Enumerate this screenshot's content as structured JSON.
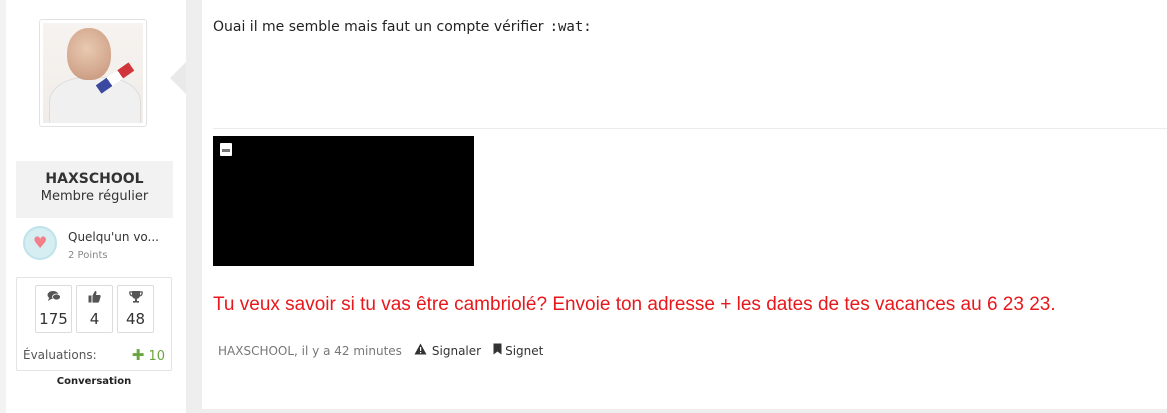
{
  "sidebar": {
    "username": "HAXSCHOOL",
    "user_title": "Membre régulier",
    "rank": {
      "name": "Quelqu'un vo...",
      "points": "2 Points",
      "icon": "heart-icon"
    },
    "stats": [
      {
        "icon": "comments-icon",
        "value": "175"
      },
      {
        "icon": "thumbs-up-icon",
        "value": "4"
      },
      {
        "icon": "trophy-icon",
        "value": "48"
      }
    ],
    "evaluations_label": "Évaluations:",
    "evaluations_value": "10",
    "conversation_label": "Conversation"
  },
  "post": {
    "message": "Ouai il me semble mais faut un compte vérifier",
    "smiley_text": ":wat:",
    "signature": "Tu veux savoir si tu vas être cambriolé? Envoie ton adresse + les dates de tes vacances au 6 23 23.",
    "meta": {
      "author_time": "HAXSCHOOL, il y a 42 minutes",
      "report_label": "Signaler",
      "bookmark_label": "Signet"
    }
  },
  "colors": {
    "signature": "#e8171b",
    "evaluation_positive": "#6aa53f",
    "page_background": "#eeeeee"
  }
}
